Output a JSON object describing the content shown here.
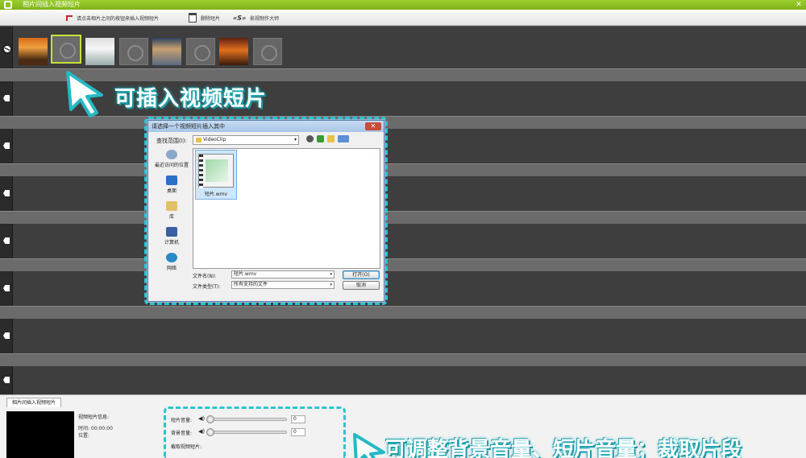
{
  "window": {
    "title": "相片间插入视频短片",
    "close_glyph": "✕"
  },
  "toolbar": {
    "hint_label": "请点击相片之间的按钮来插入视频短片",
    "delete_label": "删除短片",
    "brand_label": "影视制作大师",
    "brand_logo_text": "«S»"
  },
  "callouts": {
    "insert_text": "可插入视频短片",
    "adjust_text": "可调整背景音量、短片音量；裁取片段"
  },
  "dialog": {
    "title": "请选择一个视频短片插入其中",
    "close_glyph": "✕",
    "lookin_label": "查找范围(I):",
    "lookin_value": "VideoClip",
    "lookin_arrow": "▾",
    "places": [
      "最近访问的位置",
      "桌面",
      "库",
      "计算机",
      "网络"
    ],
    "file_name": "短片.wmv",
    "filename_label": "文件名(N):",
    "filename_value": "短片.wmv",
    "filetype_label": "文件类型(T):",
    "filetype_value": "所有支持的文件",
    "open_button": "打开(O)",
    "cancel_button": "取消"
  },
  "bottom": {
    "tab_label": "相片间插入视频短片",
    "info_title": "视频短片信息:",
    "duration_label": "时间:",
    "duration_value": "00:00:00",
    "position_label": "位置:",
    "photo_volume_label": "短片音量:",
    "photo_volume_value": "0",
    "bg_volume_label": "背景音量:",
    "bg_volume_value": "0",
    "trim_label": "截取视频短片:",
    "volume_glyph": "◀)"
  },
  "colors": {
    "accent_green": "#8cc220",
    "callout_cyan": "#2cc4d0"
  }
}
